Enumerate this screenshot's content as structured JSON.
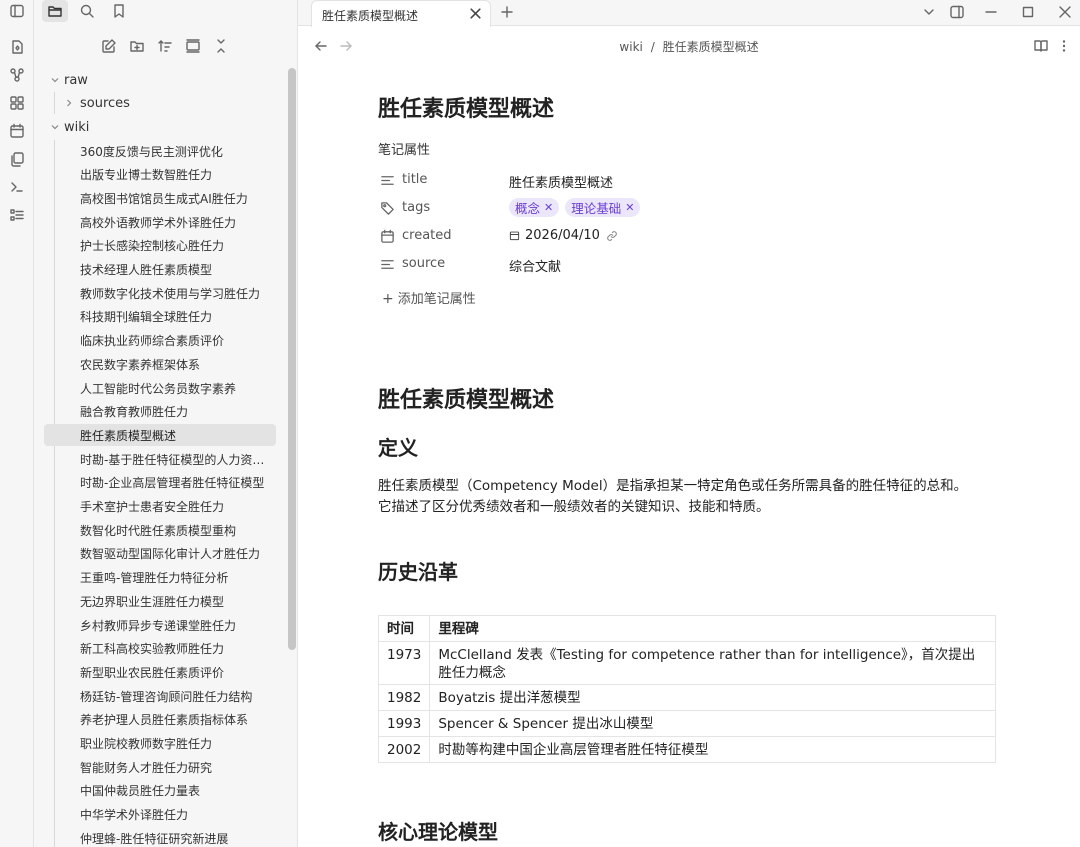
{
  "sidebar": {
    "folders": {
      "raw": "raw",
      "sources": "sources",
      "wiki": "wiki"
    },
    "files": [
      "360度反馈与民主测评优化",
      "出版专业博士数智胜任力",
      "高校图书馆馆员生成式AI胜任力",
      "高校外语教师学术外译胜任力",
      "护士长感染控制核心胜任力",
      "技术经理人胜任素质模型",
      "教师数字化技术使用与学习胜任力",
      "科技期刊编辑全球胜任力",
      "临床执业药师综合素质评价",
      "农民数字素养框架体系",
      "人工智能时代公务员数字素养",
      "融合教育教师胜任力",
      "胜任素质模型概述",
      "时勘-基于胜任特征模型的人力资源开发",
      "时勘-企业高层管理者胜任特征模型",
      "手术室护士患者安全胜任力",
      "数智化时代胜任素质模型重构",
      "数智驱动型国际化审计人才胜任力",
      "王重鸣-管理胜任力特征分析",
      "无边界职业生涯胜任力模型",
      "乡村教师异步专递课堂胜任力",
      "新工科高校实验教师胜任力",
      "新型职业农民胜任素质评价",
      "杨廷钫-管理咨询顾问胜任力结构",
      "养老护理人员胜任素质指标体系",
      "职业院校教师数字胜任力",
      "智能财务人才胜任力研究",
      "中国仲裁员胜任力量表",
      "中华学术外译胜任力",
      "仲理蜂-胜任特征研究新进展"
    ],
    "active_index": 12
  },
  "tab": {
    "title": "胜任素质模型概述"
  },
  "breadcrumb": {
    "folder": "wiki",
    "separator": "/",
    "page": "胜任素质模型概述"
  },
  "note": {
    "title": "胜任素质模型概述",
    "properties_heading": "笔记属性",
    "properties": {
      "title": {
        "key": "title",
        "value": "胜任素质模型概述"
      },
      "tags": {
        "key": "tags",
        "values": [
          "概念",
          "理论基础"
        ]
      },
      "created": {
        "key": "created",
        "value": "2026/04/10"
      },
      "source": {
        "key": "source",
        "value": "综合文献"
      }
    },
    "add_property": "添加笔记属性",
    "body_title": "胜任素质模型概述",
    "h_definition": "定义",
    "definition_line1": "胜任素质模型（Competency Model）是指承担某一特定角色或任务所需具备的胜任特征的总和。",
    "definition_line2": "它描述了区分优秀绩效者和一般绩效者的关键知识、技能和特质。",
    "h_history": "历史沿革",
    "table": {
      "headers": [
        "时间",
        "里程碑"
      ],
      "rows": [
        [
          "1973",
          "McClelland 发表《Testing for competence rather than for intelligence》，首次提出胜任力概念"
        ],
        [
          "1982",
          "Boyatzis 提出洋葱模型"
        ],
        [
          "1993",
          "Spencer & Spencer 提出冰山模型"
        ],
        [
          "2002",
          "时勘等构建中国企业高层管理者胜任特征模型"
        ]
      ]
    },
    "h_core": "核心理论模型"
  },
  "colors": {
    "accent": "#6a3fd1",
    "tag_bg": "#ece6fb"
  }
}
